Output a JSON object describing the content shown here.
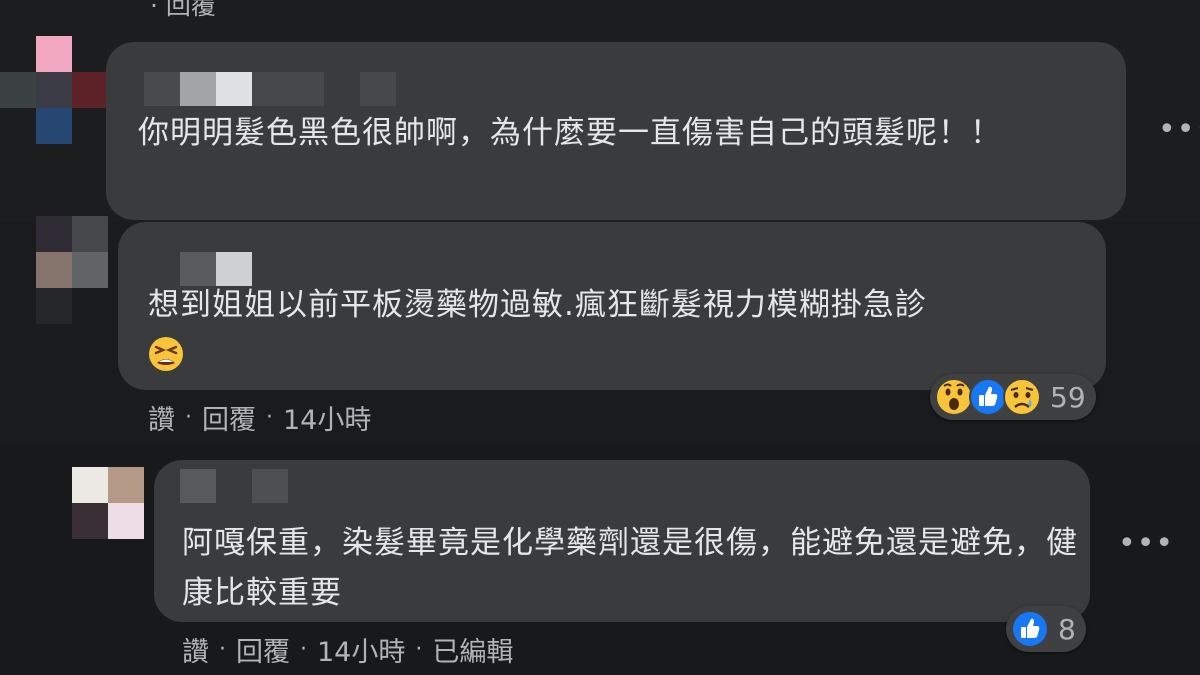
{
  "previous_action": "·  回覆",
  "comments": [
    {
      "text": "你明明髮色黑色很帥啊，為什麼要一直傷害自己的頭髮呢！！",
      "more_label": "•••"
    },
    {
      "text": "想到姐姐以前平板燙藥物過敏.瘋狂斷髮視力模糊掛急診",
      "emoji": "tired-face-emoji",
      "actions": {
        "like": "讚",
        "reply": "回覆",
        "time": "14小時"
      },
      "reactions": {
        "icons": [
          "wow-emoji",
          "like-icon",
          "sad-emoji"
        ],
        "count": "59"
      }
    },
    {
      "text": "阿嘎保重，染髮畢竟是化學藥劑還是很傷，能避免還是避免，健康比較重要",
      "more_label": "•••",
      "actions": {
        "like": "讚",
        "reply": "回覆",
        "time": "14小時",
        "edited": "已編輯"
      },
      "reactions": {
        "icons": [
          "like-icon"
        ],
        "count": "8"
      }
    }
  ],
  "colors": {
    "bubble": "#3a3b3c",
    "text": "#e4e6eb",
    "secondary": "#b0b3b8",
    "like_blue": "#1877f2"
  }
}
